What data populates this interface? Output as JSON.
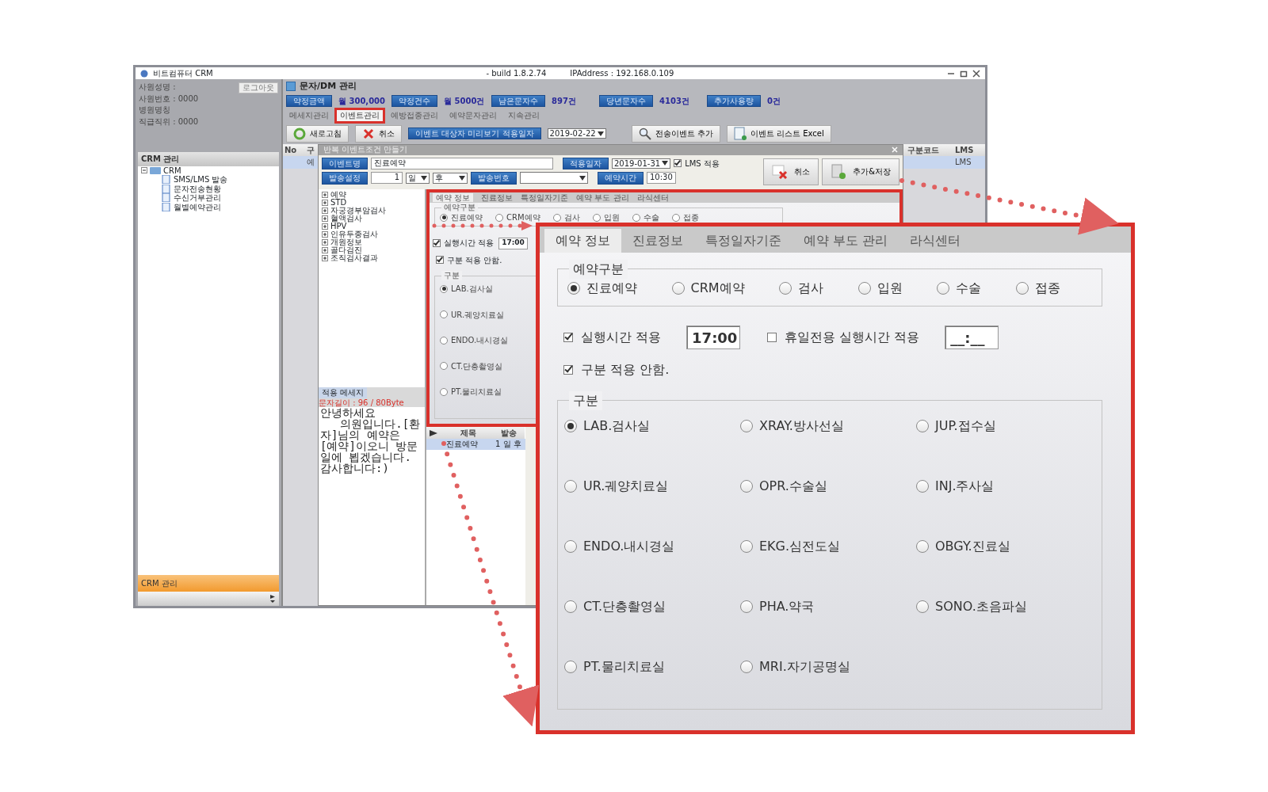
{
  "window": {
    "title": "비트컴퓨터 CRM",
    "build": "- build 1.8.2.74",
    "ip": "IPAddress : 192.168.0.109"
  },
  "user_info": {
    "lines": [
      "사원성명 :",
      "사원번호 : 0000",
      "병원명칭",
      "직급직위 : 0000"
    ],
    "logout": "로그아웃"
  },
  "sidebar": {
    "title": "CRM 관리",
    "tree": [
      {
        "label": "CRM",
        "expanded": true,
        "children": [
          {
            "label": "SMS/LMS 발송"
          },
          {
            "label": "문자전송현황"
          },
          {
            "label": "수신거부관리"
          },
          {
            "label": "월별예약관리"
          }
        ]
      }
    ],
    "footer": "CRM 관리"
  },
  "module_title": "문자/DM 관리",
  "stats": [
    {
      "label": "약정금액",
      "value": "월 300,000"
    },
    {
      "label": "약정건수",
      "value": "월 5000건"
    },
    {
      "label": "남은문자수",
      "value": "897건"
    },
    {
      "label": "당년문자수",
      "value": "4103건"
    },
    {
      "label": "추가사용량",
      "value": "0건"
    }
  ],
  "tabs": [
    {
      "label": "메세지관리",
      "selected": false
    },
    {
      "label": "이벤트관리",
      "selected": true
    },
    {
      "label": "예방접종관리",
      "selected": false
    },
    {
      "label": "예약문자관리",
      "selected": false
    },
    {
      "label": "지속관리",
      "selected": false
    }
  ],
  "toolbar": {
    "refresh": "새로고침",
    "cancel": "취소",
    "preview_label": "이벤트 대상자 미리보기 적용일자",
    "date": "2019-02-22",
    "add": "전송이벤트 추가",
    "excel": "이벤트 리스트 Excel"
  },
  "grid": {
    "columns": [
      {
        "label": "No"
      },
      {
        "label": "구",
        "cell": "예"
      },
      {
        "label": "구분코드"
      },
      {
        "label": "LMS",
        "cell": "LMS"
      }
    ]
  },
  "dialog": {
    "title": "반복 이벤트조건 만들기",
    "event_name": {
      "label": "이벤트명",
      "value": "진료예약"
    },
    "send_setting": {
      "label": "발송설정",
      "value": "1",
      "unit": "일",
      "when": "후"
    },
    "send_number": {
      "label": "발송번호"
    },
    "apply_date": {
      "label": "적용일자",
      "value": "2019-01-31"
    },
    "lms": {
      "label": "LMS 적용",
      "checked": true
    },
    "reserve_time": {
      "label": "예약시간",
      "value": "10:30"
    },
    "buttons": [
      "취소",
      "추가&저장"
    ],
    "tree": [
      "예약",
      "STD",
      "자궁경부암검사",
      "혈액검사",
      "HPV",
      "인유두종검사",
      "개원정보",
      "골다검진",
      "조직검사결과"
    ],
    "message": {
      "label": "적용 메세지",
      "length": "문자길이 : 96 / 80Byte",
      "text": "안녕하세요\n   의원입니다.[환자]님의 예약은 [예약]이오니 방문일에 뵙겠습니다. 감사합니다:)"
    },
    "list": {
      "columns": [
        "제목",
        "발송"
      ],
      "rows": [
        [
          "진료예약",
          "1 일 후"
        ]
      ]
    }
  },
  "preview_panel": {
    "tabs": [
      {
        "label": "예약 정보",
        "selected": true
      },
      {
        "label": "진료정보",
        "selected": false
      },
      {
        "label": "특정일자기준",
        "selected": false
      },
      {
        "label": "예약 부도 관리",
        "selected": false
      },
      {
        "label": "라식센터",
        "selected": false
      }
    ],
    "type_group": {
      "title": "예약구분",
      "options": [
        {
          "label": "진료예약",
          "selected": true
        },
        {
          "label": "CRM예약",
          "selected": false
        },
        {
          "label": "검사",
          "selected": false
        },
        {
          "label": "입원",
          "selected": false
        },
        {
          "label": "수술",
          "selected": false
        },
        {
          "label": "접종",
          "selected": false
        }
      ]
    },
    "exec_time": {
      "label": "실행시간 적용",
      "checked": true,
      "value": "17:00"
    },
    "no_category": {
      "label": "구분 적용 안함.",
      "checked": true
    },
    "category_group": {
      "title": "구분",
      "options": [
        {
          "label": "LAB.검사실",
          "selected": true
        },
        {
          "label": "UR.궤양치료실",
          "selected": false
        },
        {
          "label": "ENDO.내시경실",
          "selected": false
        },
        {
          "label": "CT.단층촬영실",
          "selected": false
        },
        {
          "label": "PT.물리치료실",
          "selected": false
        }
      ]
    }
  },
  "zoom_panel": {
    "tabs": [
      {
        "label": "예약 정보",
        "selected": true
      },
      {
        "label": "진료정보",
        "selected": false
      },
      {
        "label": "특정일자기준",
        "selected": false
      },
      {
        "label": "예약 부도 관리",
        "selected": false
      },
      {
        "label": "라식센터",
        "selected": false
      }
    ],
    "type_group": {
      "title": "예약구분",
      "options": [
        {
          "label": "진료예약",
          "selected": true
        },
        {
          "label": "CRM예약",
          "selected": false
        },
        {
          "label": "검사",
          "selected": false
        },
        {
          "label": "입원",
          "selected": false
        },
        {
          "label": "수술",
          "selected": false
        },
        {
          "label": "접종",
          "selected": false
        }
      ]
    },
    "exec_time": {
      "label": "실행시간 적용",
      "checked": true,
      "value": "17:00"
    },
    "holiday_time": {
      "label": "휴일전용 실행시간 적용",
      "checked": false,
      "value": "__:__"
    },
    "no_category": {
      "label": "구분 적용 안함.",
      "checked": true
    },
    "category_group": {
      "title": "구분",
      "options": [
        {
          "label": "LAB.검사실",
          "selected": true
        },
        {
          "label": "XRAY.방사선실",
          "selected": false
        },
        {
          "label": "JUP.접수실",
          "selected": false
        },
        {
          "label": "UR.궤양치료실",
          "selected": false
        },
        {
          "label": "OPR.수술실",
          "selected": false
        },
        {
          "label": "INJ.주사실",
          "selected": false
        },
        {
          "label": "ENDO.내시경실",
          "selected": false
        },
        {
          "label": "EKG.심전도실",
          "selected": false
        },
        {
          "label": "OBGY.진료실",
          "selected": false
        },
        {
          "label": "CT.단층촬영실",
          "selected": false
        },
        {
          "label": "PHA.약국",
          "selected": false
        },
        {
          "label": "SONO.초음파실",
          "selected": false
        },
        {
          "label": "PT.물리치료실",
          "selected": false
        },
        {
          "label": "MRI.자기공명실",
          "selected": false
        }
      ]
    }
  }
}
